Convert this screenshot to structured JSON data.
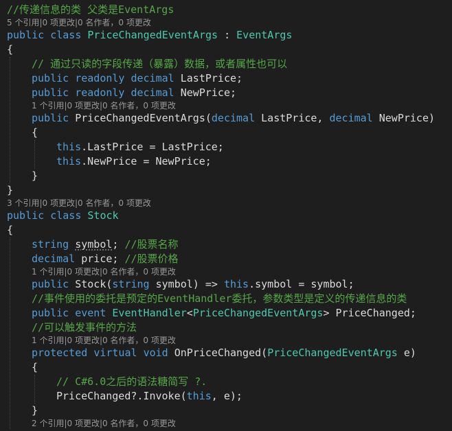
{
  "colors": {
    "background": "#1e1e1e",
    "keyword": "#569cd6",
    "type": "#4ec9b0",
    "comment": "#57a64a",
    "text": "#dcdcdc",
    "codelens": "#999999"
  },
  "lines": [
    {
      "kind": "code",
      "indent": 0,
      "tokens": [
        {
          "c": "cm",
          "t": "//传递信息的类 父类是EventArgs"
        }
      ]
    },
    {
      "kind": "lens",
      "indent": 0,
      "text": "5 个引用|0 项更改|0 名作者，0 项更改"
    },
    {
      "kind": "code",
      "indent": 0,
      "tokens": [
        {
          "c": "kw",
          "t": "public"
        },
        {
          "c": "tx",
          "t": " "
        },
        {
          "c": "kw",
          "t": "class"
        },
        {
          "c": "tx",
          "t": " "
        },
        {
          "c": "ty",
          "t": "PriceChangedEventArgs"
        },
        {
          "c": "tx",
          "t": " : "
        },
        {
          "c": "ty",
          "t": "EventArgs"
        }
      ]
    },
    {
      "kind": "code",
      "indent": 0,
      "tokens": [
        {
          "c": "tx",
          "t": "{"
        }
      ]
    },
    {
      "kind": "code",
      "indent": 1,
      "tokens": [
        {
          "c": "cm",
          "t": "// 通过只读的字段传递（暴露）数据，或者属性也可以"
        }
      ]
    },
    {
      "kind": "code",
      "indent": 1,
      "tokens": [
        {
          "c": "kw",
          "t": "public"
        },
        {
          "c": "tx",
          "t": " "
        },
        {
          "c": "kw",
          "t": "readonly"
        },
        {
          "c": "tx",
          "t": " "
        },
        {
          "c": "kw",
          "t": "decimal"
        },
        {
          "c": "tx",
          "t": " LastPrice;"
        }
      ]
    },
    {
      "kind": "code",
      "indent": 1,
      "tokens": [
        {
          "c": "kw",
          "t": "public"
        },
        {
          "c": "tx",
          "t": " "
        },
        {
          "c": "kw",
          "t": "readonly"
        },
        {
          "c": "tx",
          "t": " "
        },
        {
          "c": "kw",
          "t": "decimal"
        },
        {
          "c": "tx",
          "t": " NewPrice;"
        }
      ]
    },
    {
      "kind": "lens",
      "indent": 1,
      "text": "1 个引用|0 项更改|0 名作者，0 项更改"
    },
    {
      "kind": "code",
      "indent": 1,
      "tokens": [
        {
          "c": "kw",
          "t": "public"
        },
        {
          "c": "tx",
          "t": " PriceChangedEventArgs("
        },
        {
          "c": "kw",
          "t": "decimal"
        },
        {
          "c": "tx",
          "t": " LastPrice, "
        },
        {
          "c": "kw",
          "t": "decimal"
        },
        {
          "c": "tx",
          "t": " NewPrice)"
        }
      ]
    },
    {
      "kind": "code",
      "indent": 1,
      "tokens": [
        {
          "c": "tx",
          "t": "{"
        }
      ]
    },
    {
      "kind": "code",
      "indent": 2,
      "tokens": [
        {
          "c": "kw",
          "t": "this"
        },
        {
          "c": "tx",
          "t": ".LastPrice = LastPrice;"
        }
      ]
    },
    {
      "kind": "code",
      "indent": 2,
      "tokens": [
        {
          "c": "kw",
          "t": "this"
        },
        {
          "c": "tx",
          "t": ".NewPrice = NewPrice;"
        }
      ]
    },
    {
      "kind": "code",
      "indent": 1,
      "tokens": [
        {
          "c": "tx",
          "t": "}"
        }
      ]
    },
    {
      "kind": "code",
      "indent": 0,
      "tokens": [
        {
          "c": "tx",
          "t": "}"
        }
      ]
    },
    {
      "kind": "lens",
      "indent": 0,
      "text": "3 个引用|0 项更改|0 名作者，0 项更改"
    },
    {
      "kind": "code",
      "indent": 0,
      "tokens": [
        {
          "c": "kw",
          "t": "public"
        },
        {
          "c": "tx",
          "t": " "
        },
        {
          "c": "kw",
          "t": "class"
        },
        {
          "c": "tx",
          "t": " "
        },
        {
          "c": "ty",
          "t": "Stock"
        }
      ]
    },
    {
      "kind": "code",
      "indent": 0,
      "tokens": [
        {
          "c": "tx",
          "t": "{"
        }
      ]
    },
    {
      "kind": "code",
      "indent": 1,
      "tokens": [
        {
          "c": "kw",
          "t": "string"
        },
        {
          "c": "tx",
          "t": " "
        },
        {
          "c": "tx sq",
          "t": "symbol"
        },
        {
          "c": "tx",
          "t": "; "
        },
        {
          "c": "cm",
          "t": "//股票名称"
        }
      ]
    },
    {
      "kind": "code",
      "indent": 1,
      "tokens": [
        {
          "c": "kw",
          "t": "decimal"
        },
        {
          "c": "tx",
          "t": " price; "
        },
        {
          "c": "cm",
          "t": "//股票价格"
        }
      ]
    },
    {
      "kind": "lens",
      "indent": 1,
      "text": "1 个引用|0 项更改|0 名作者，0 项更改"
    },
    {
      "kind": "code",
      "indent": 1,
      "tokens": [
        {
          "c": "kw",
          "t": "public"
        },
        {
          "c": "tx",
          "t": " Stock("
        },
        {
          "c": "kw",
          "t": "string"
        },
        {
          "c": "tx",
          "t": " symbol) => "
        },
        {
          "c": "kw",
          "t": "this"
        },
        {
          "c": "tx",
          "t": ".symbol = symbol;"
        }
      ]
    },
    {
      "kind": "code",
      "indent": 1,
      "tokens": [
        {
          "c": "cm",
          "t": "//事件使用的委托是预定的EventHandler委托，参数类型是定义的传递信息的类"
        }
      ]
    },
    {
      "kind": "code",
      "indent": 1,
      "tokens": [
        {
          "c": "kw",
          "t": "public"
        },
        {
          "c": "tx",
          "t": " "
        },
        {
          "c": "kw",
          "t": "event"
        },
        {
          "c": "tx",
          "t": " "
        },
        {
          "c": "ty",
          "t": "EventHandler"
        },
        {
          "c": "tx",
          "t": "<"
        },
        {
          "c": "ty",
          "t": "PriceChangedEventArgs"
        },
        {
          "c": "tx",
          "t": "> PriceChanged;"
        }
      ]
    },
    {
      "kind": "code",
      "indent": 1,
      "tokens": [
        {
          "c": "cm",
          "t": "//可以触发事件的方法"
        }
      ]
    },
    {
      "kind": "lens",
      "indent": 1,
      "text": "1 个引用|0 项更改|0 名作者，0 项更改"
    },
    {
      "kind": "code",
      "indent": 1,
      "tokens": [
        {
          "c": "kw",
          "t": "protected"
        },
        {
          "c": "tx",
          "t": " "
        },
        {
          "c": "kw",
          "t": "virtual"
        },
        {
          "c": "tx",
          "t": " "
        },
        {
          "c": "kw",
          "t": "void"
        },
        {
          "c": "tx",
          "t": " OnPriceChanged("
        },
        {
          "c": "ty",
          "t": "PriceChangedEventArgs"
        },
        {
          "c": "tx",
          "t": " e)"
        }
      ]
    },
    {
      "kind": "code",
      "indent": 1,
      "tokens": [
        {
          "c": "tx",
          "t": "{"
        }
      ]
    },
    {
      "kind": "code",
      "indent": 2,
      "tokens": [
        {
          "c": "cm",
          "t": "// C#6.0之后的语法糖简写 ?."
        }
      ]
    },
    {
      "kind": "code",
      "indent": 2,
      "tokens": [
        {
          "c": "tx",
          "t": "PriceChanged?.Invoke("
        },
        {
          "c": "kw",
          "t": "this"
        },
        {
          "c": "tx",
          "t": ", e);"
        }
      ]
    },
    {
      "kind": "code",
      "indent": 1,
      "tokens": [
        {
          "c": "tx",
          "t": "}"
        }
      ]
    },
    {
      "kind": "lens",
      "indent": 1,
      "text": "2 个引用|0 项更改|0 名作者，0 项更改"
    }
  ]
}
